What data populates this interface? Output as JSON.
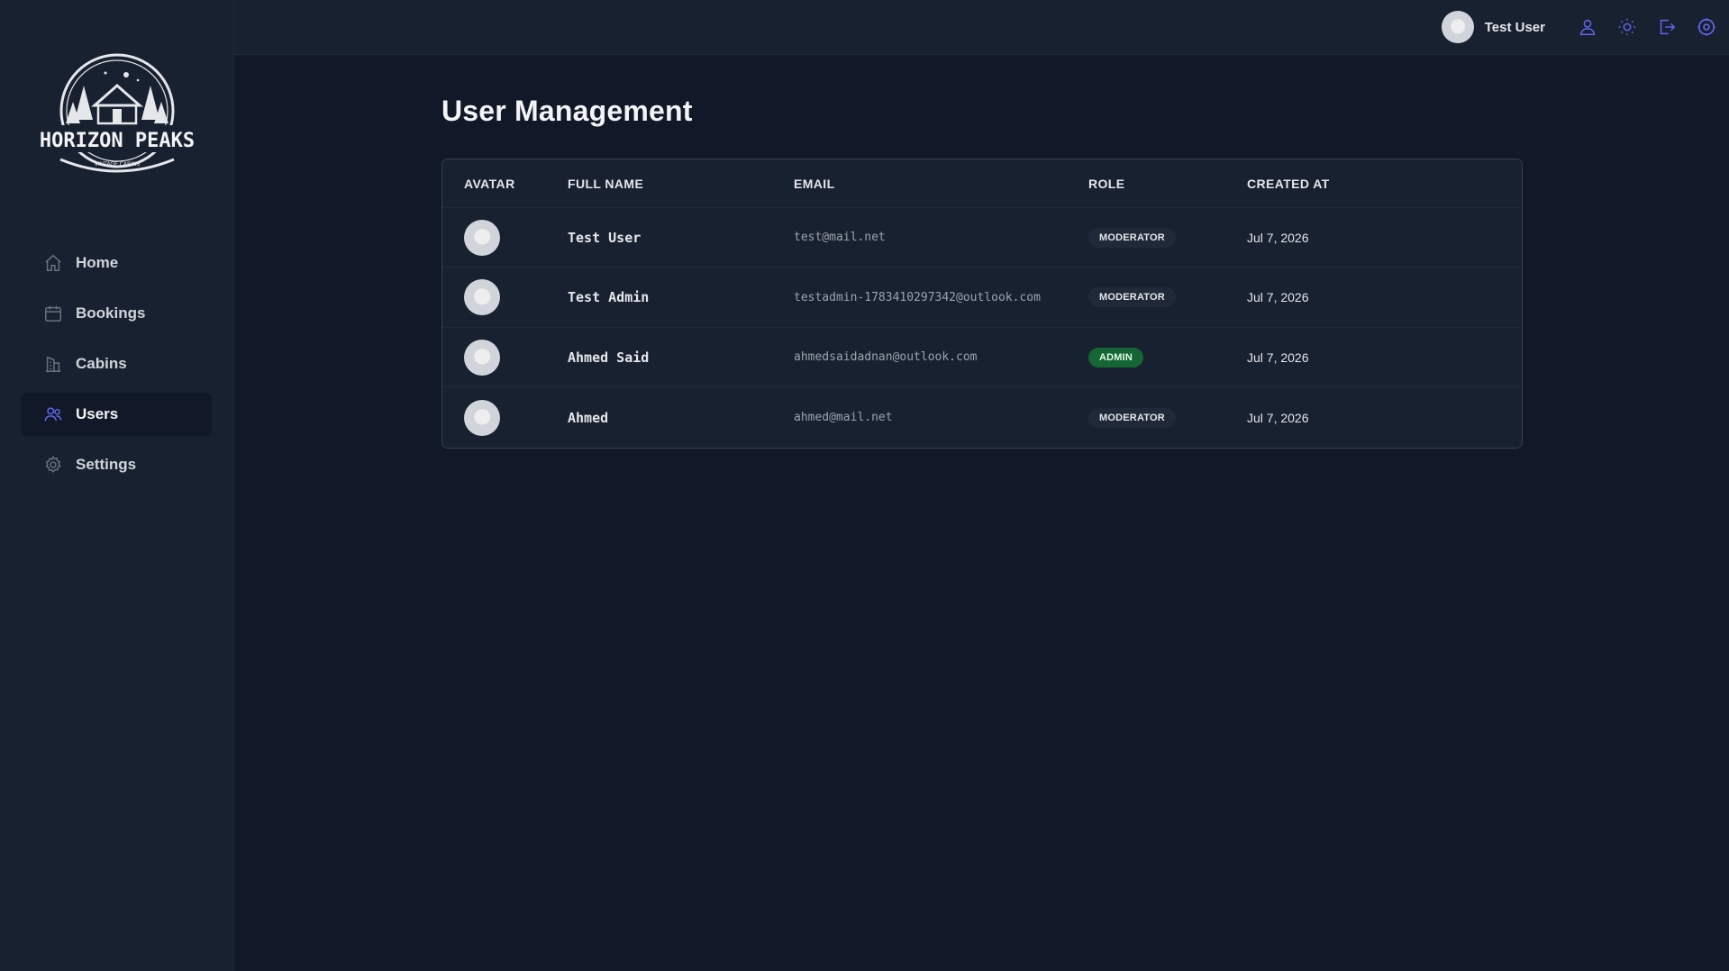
{
  "brand": {
    "name": "HORIZON PEAKS",
    "tagline": "VINTAGE CABINS"
  },
  "sidebar": {
    "items": [
      {
        "label": "Home",
        "icon": "home-icon",
        "active": false
      },
      {
        "label": "Bookings",
        "icon": "calendar-icon",
        "active": false
      },
      {
        "label": "Cabins",
        "icon": "building-icon",
        "active": false
      },
      {
        "label": "Users",
        "icon": "users-icon",
        "active": true
      },
      {
        "label": "Settings",
        "icon": "gear-icon",
        "active": false
      }
    ]
  },
  "topbar": {
    "user_name": "Test User",
    "icons": [
      "user-icon",
      "sun-icon",
      "logout-icon",
      "gear-icon"
    ]
  },
  "page": {
    "title": "User Management"
  },
  "table": {
    "columns": [
      "Avatar",
      "Full Name",
      "Email",
      "Role",
      "Created At"
    ],
    "rows": [
      {
        "full_name": "Test User",
        "email": "test@mail.net",
        "role": "MODERATOR",
        "created_at": "Jul 7, 2026"
      },
      {
        "full_name": "Test Admin",
        "email": "testadmin-1783410297342@outlook.com",
        "role": "MODERATOR",
        "created_at": "Jul 7, 2026"
      },
      {
        "full_name": "Ahmed Said",
        "email": "ahmedsaidadnan@outlook.com",
        "role": "ADMIN",
        "created_at": "Jul 7, 2026"
      },
      {
        "full_name": "Ahmed",
        "email": "ahmed@mail.net",
        "role": "MODERATOR",
        "created_at": "Jul 7, 2026"
      }
    ]
  },
  "colors": {
    "accent": "#6366f1",
    "admin_badge": "#166534",
    "background": "#111827",
    "panel": "#18212f"
  }
}
